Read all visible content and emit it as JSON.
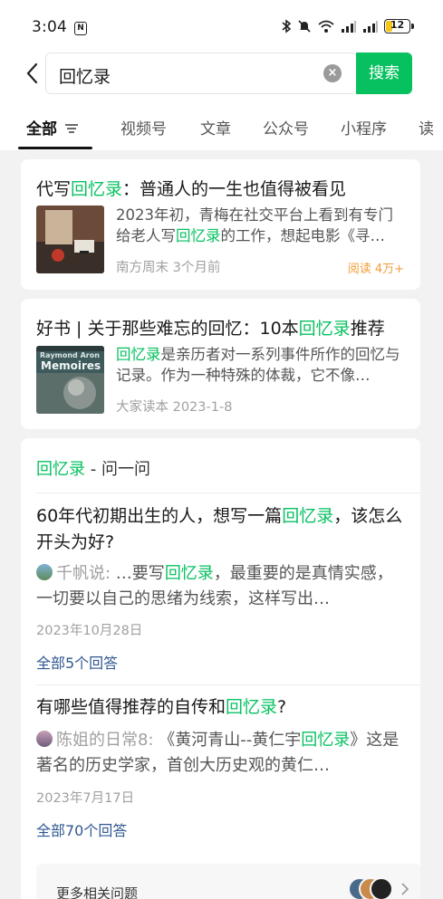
{
  "status_bar": {
    "time": "3:04",
    "notif_icon": "N",
    "battery": "12"
  },
  "search": {
    "query": "回忆录",
    "button_label": "搜索"
  },
  "tabs": [
    {
      "label": "全部",
      "active": true
    },
    {
      "label": "视频号"
    },
    {
      "label": "文章"
    },
    {
      "label": "公众号"
    },
    {
      "label": "小程序"
    },
    {
      "label": "读"
    }
  ],
  "articles": [
    {
      "title_pre": "代写",
      "title_hl": "回忆录",
      "title_post": "：普通人的一生也值得被看见",
      "snippet_pre": "2023年初，青梅在社交平台上看到有专门给老人写",
      "snippet_hl": "回忆录",
      "snippet_post": "的工作，想起电影《寻…",
      "source": "南方周末",
      "time": "3个月前",
      "reads": "阅读 4万+"
    },
    {
      "title_pre": "好书 | 关于那些难忘的回忆：10本",
      "title_hl": "回忆录",
      "title_post": "推荐",
      "snippet_pre": "",
      "snippet_hl": "回忆录",
      "snippet_post": "是亲历者对一系列事件所作的回忆与记录。作为一种特殊的体裁，它不像…",
      "source": "大家读本",
      "time": "2023-1-8",
      "thumb_text_1": "Memoires",
      "thumb_text_2": "Raymond Aron"
    }
  ],
  "qa": {
    "header_hl": "回忆录",
    "header_rest": " - 问一问",
    "questions": [
      {
        "title_pre": "60年代初期出生的人，想写一篇",
        "title_hl": "回忆录",
        "title_post": "，该怎么开头为好?",
        "user": "千帆说:",
        "snip_pre": " …要写",
        "snip_hl": "回忆录",
        "snip_post": "，最重要的是真情实感，一切要以自己的思绪为线索，这样写出…",
        "date": "2023年10月28日",
        "answers": "全部5个回答"
      },
      {
        "title_pre": "有哪些值得推荐的自传和",
        "title_hl": "回忆录",
        "title_post": "?",
        "user": "陈姐的日常8:",
        "snip_pre": " 《黄河青山--黄仁宇",
        "snip_hl": "回忆录",
        "snip_post": "》这是著名的历史学家，首创大历史观的黄仁…",
        "date": "2023年7月17日",
        "answers": "全部70个回答"
      }
    ],
    "more_label": "更多相关问题"
  },
  "colors": {
    "accent": "#07c160",
    "link": "#2f5791",
    "reads": "#f29d38"
  }
}
